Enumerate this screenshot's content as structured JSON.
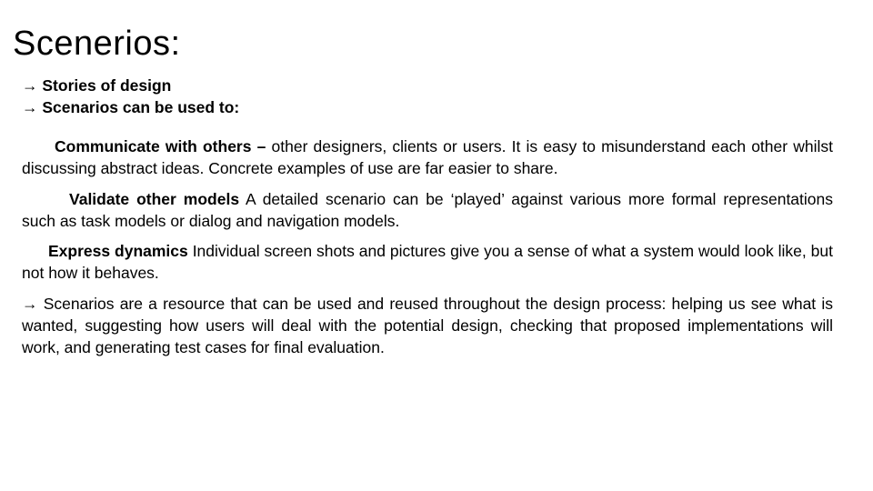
{
  "slide": {
    "title": "Scenerios:",
    "bullets": [
      {
        "arrow": "→",
        "text": "Stories of design"
      },
      {
        "arrow": "→",
        "text": "Scenarios can be used to:"
      }
    ],
    "uses": [
      {
        "lead": "Communicate with others –",
        "text": " other designers, clients or users. It is easy to misunderstand each other whilst discussing abstract ideas. Concrete examples of use are far easier to share."
      },
      {
        "lead": "Validate other models",
        "text": " A detailed scenario can be ‘played’ against various more formal representations such as task models or dialog and navigation models."
      },
      {
        "lead": "Express dynamics",
        "text": " Individual screen shots and pictures give you a sense of what a system would look like, but not how it behaves."
      }
    ],
    "closing": {
      "arrow": "→",
      "text": " Scenarios are a resource that can be used and reused throughout the design process: helping us see what is wanted, suggesting how users will deal with the potential design, checking that proposed implementations will work, and generating test cases for final evaluation."
    }
  }
}
